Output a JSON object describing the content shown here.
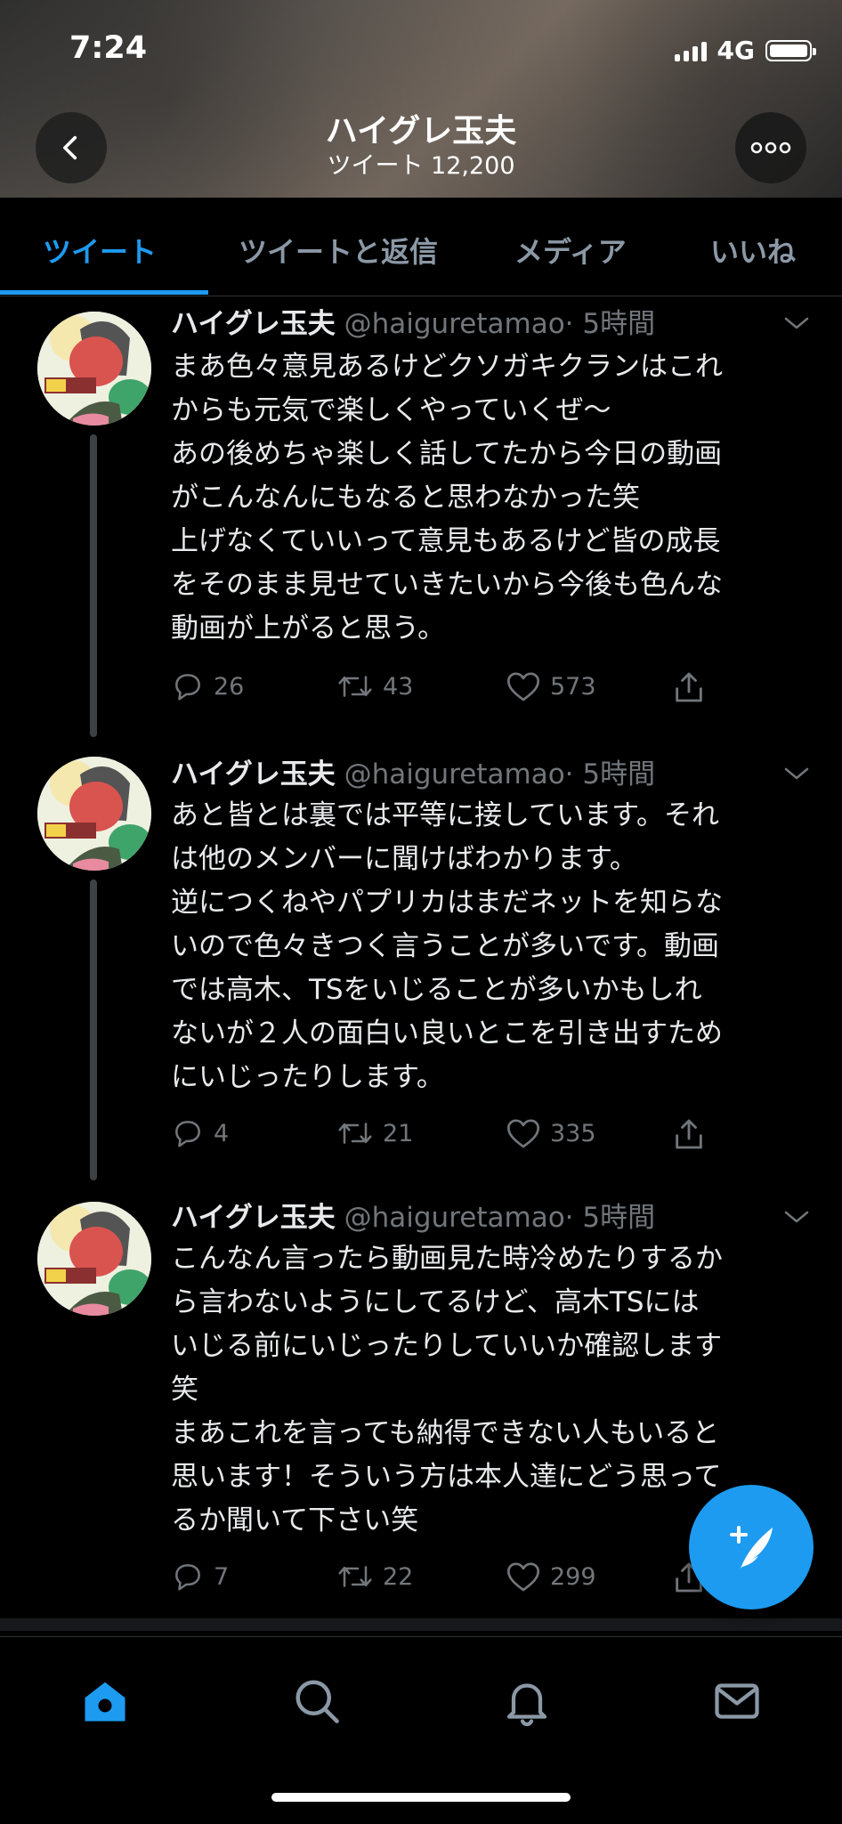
{
  "status_bar": {
    "time": "7:24",
    "network": "4G"
  },
  "header": {
    "title": "ハイグレ玉夫",
    "subtitle": "ツイート 12,200"
  },
  "tabs": [
    {
      "label": "ツイート",
      "active": true
    },
    {
      "label": "ツイートと返信",
      "active": false
    },
    {
      "label": "メディア",
      "active": false
    },
    {
      "label": "いいね",
      "active": false
    }
  ],
  "tweets": [
    {
      "name": "ハイグレ玉夫",
      "handle": "@haiguretamao",
      "time": "· 5時間",
      "lines": [
        "まあ色々意見あるけどクソガキクランはこれ",
        "からも元気で楽しくやっていくぜ〜",
        "あの後めちゃ楽しく話してたから今日の動画",
        "がこんなんにもなると思わなかった笑",
        "上げなくていいって意見もあるけど皆の成長",
        "をそのまま見せていきたいから今後も色んな",
        "動画が上がると思う。"
      ],
      "replies": "26",
      "retweets": "43",
      "likes": "573"
    },
    {
      "name": "ハイグレ玉夫",
      "handle": "@haiguretamao",
      "time": "· 5時間",
      "lines": [
        "あと皆とは裏では平等に接しています。それ",
        "は他のメンバーに聞けばわかります。",
        "逆につくねやパプリカはまだネットを知らな",
        "いので色々きつく言うことが多いです。動画",
        "では高木、TSをいじることが多いかもしれ",
        "ないが２人の面白い良いとこを引き出すため",
        "にいじったりします。"
      ],
      "replies": "4",
      "retweets": "21",
      "likes": "335"
    },
    {
      "name": "ハイグレ玉夫",
      "handle": "@haiguretamao",
      "time": "· 5時間",
      "lines": [
        "こんなん言ったら動画見た時冷めたりするか",
        "ら言わないようにしてるけど、高木TSには",
        "いじる前にいじったりしていいか確認します",
        "笑",
        "まあこれを言っても納得できない人もいると",
        "思います！そういう方は本人達にどう思って",
        "るか聞いて下さい笑"
      ],
      "replies": "7",
      "retweets": "22",
      "likes": "299"
    }
  ],
  "colors": {
    "accent": "#1d9bf0",
    "background": "#000000",
    "muted": "#71767b"
  },
  "icons": [
    "back-arrow-icon",
    "more-icon",
    "reply-icon",
    "retweet-icon",
    "like-icon",
    "share-icon",
    "compose-icon",
    "home-icon",
    "search-icon",
    "notifications-icon",
    "messages-icon"
  ]
}
